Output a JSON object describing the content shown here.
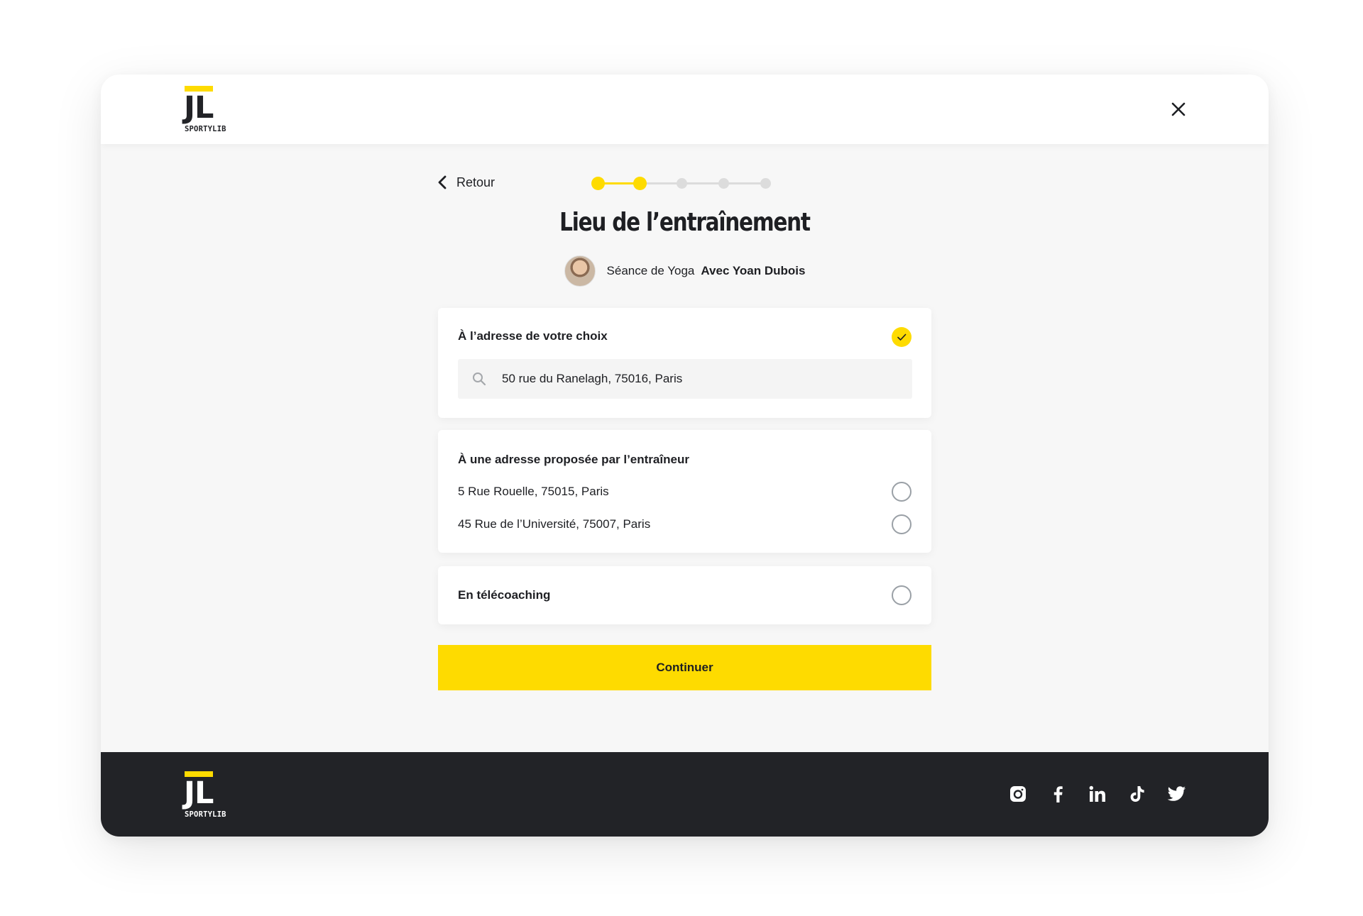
{
  "colors": {
    "accent": "#fedb00",
    "dark": "#222327",
    "inactive_step": "#dcdcdc"
  },
  "brand": {
    "logo_letters": "JL",
    "logo_word": "SPORTYLIB"
  },
  "header": {
    "close_icon": "close-icon"
  },
  "nav": {
    "back_label": "Retour",
    "back_icon": "chevron-left-icon"
  },
  "stepper": {
    "total_steps": 5,
    "current_step": 2
  },
  "page": {
    "title": "Lieu de l’entraînement"
  },
  "session": {
    "activity": "Séance de Yoga",
    "coach": "Avec Yoan Dubois"
  },
  "options": {
    "custom": {
      "title": "À l’adresse de votre choix",
      "selected": true,
      "search_value": "50 rue du Ranelagh, 75016, Paris",
      "search_icon": "search-icon"
    },
    "trainer": {
      "title": "À une adresse proposée par l’entraîneur",
      "addresses": [
        {
          "label": "5 Rue Rouelle, 75015, Paris",
          "selected": false
        },
        {
          "label": "45 Rue de l’Université, 75007, Paris",
          "selected": false
        }
      ]
    },
    "remote": {
      "title": "En télécoaching",
      "selected": false
    }
  },
  "cta": {
    "label": "Continuer"
  },
  "footer": {
    "socials": [
      "instagram-icon",
      "facebook-icon",
      "linkedin-icon",
      "tiktok-icon",
      "twitter-icon"
    ]
  }
}
